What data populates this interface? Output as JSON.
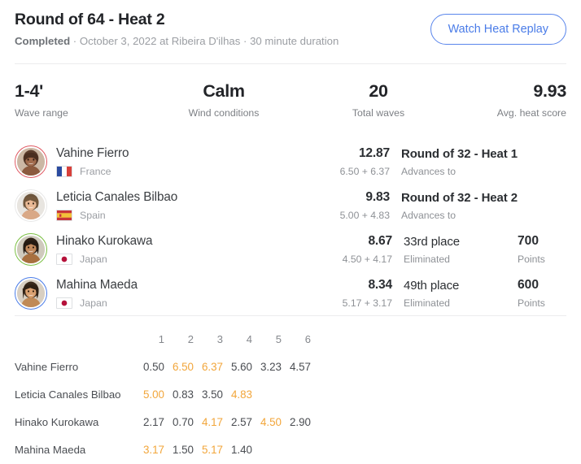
{
  "header": {
    "title": "Round of 64 - Heat 2",
    "status": "Completed",
    "meta": " · October 3, 2022 at Ribeira D'ilhas · 30 minute duration",
    "replay_button": "Watch Heat Replay",
    "accent_blue": "#4a7ce8"
  },
  "stats": [
    {
      "value": "1-4'",
      "label": "Wave range"
    },
    {
      "value": "Calm",
      "label": "Wind conditions"
    },
    {
      "value": "20",
      "label": "Total waves"
    },
    {
      "value": "9.93",
      "label": "Avg. heat score"
    }
  ],
  "athletes": [
    {
      "name": "Vahine Fierro",
      "nation": "France",
      "flag": "flag-france",
      "jersey_color": "#e05a63",
      "total": "12.87",
      "parts": "6.50 + 6.37",
      "result": "Round of 32 - Heat 1",
      "result_bold": true,
      "result_sub": "Advances to",
      "points": "",
      "points_label": ""
    },
    {
      "name": "Leticia Canales Bilbao",
      "nation": "Spain",
      "flag": "flag-spain",
      "jersey_color": "#e8e8e8",
      "total": "9.83",
      "parts": "5.00 + 4.83",
      "result": "Round of 32 - Heat 2",
      "result_bold": true,
      "result_sub": "Advances to",
      "points": "",
      "points_label": ""
    },
    {
      "name": "Hinako Kurokawa",
      "nation": "Japan",
      "flag": "flag-japan",
      "jersey_color": "#7bc043",
      "total": "8.67",
      "parts": "4.50 + 4.17",
      "result": "33rd place",
      "result_bold": false,
      "result_sub": "Eliminated",
      "points": "700",
      "points_label": "Points"
    },
    {
      "name": "Mahina Maeda",
      "nation": "Japan",
      "flag": "flag-japan",
      "jersey_color": "#4a7ce8",
      "total": "8.34",
      "parts": "5.17 + 3.17",
      "result": "49th place",
      "result_bold": false,
      "result_sub": "Eliminated",
      "points": "600",
      "points_label": "Points"
    }
  ],
  "wave_table": {
    "counted_color": "#f2a63b",
    "columns": [
      "1",
      "2",
      "3",
      "4",
      "5",
      "6"
    ],
    "rows": [
      {
        "name": "Vahine Fierro",
        "scores": [
          "0.50",
          "6.50",
          "6.37",
          "5.60",
          "3.23",
          "4.57"
        ],
        "counted": [
          false,
          true,
          true,
          false,
          false,
          false
        ]
      },
      {
        "name": "Leticia Canales Bilbao",
        "scores": [
          "5.00",
          "0.83",
          "3.50",
          "4.83",
          "",
          ""
        ],
        "counted": [
          true,
          false,
          false,
          true,
          false,
          false
        ]
      },
      {
        "name": "Hinako Kurokawa",
        "scores": [
          "2.17",
          "0.70",
          "4.17",
          "2.57",
          "4.50",
          "2.90"
        ],
        "counted": [
          false,
          false,
          true,
          false,
          true,
          false
        ]
      },
      {
        "name": "Mahina Maeda",
        "scores": [
          "3.17",
          "1.50",
          "5.17",
          "1.40",
          "",
          ""
        ],
        "counted": [
          true,
          false,
          true,
          false,
          false,
          false
        ]
      }
    ]
  }
}
